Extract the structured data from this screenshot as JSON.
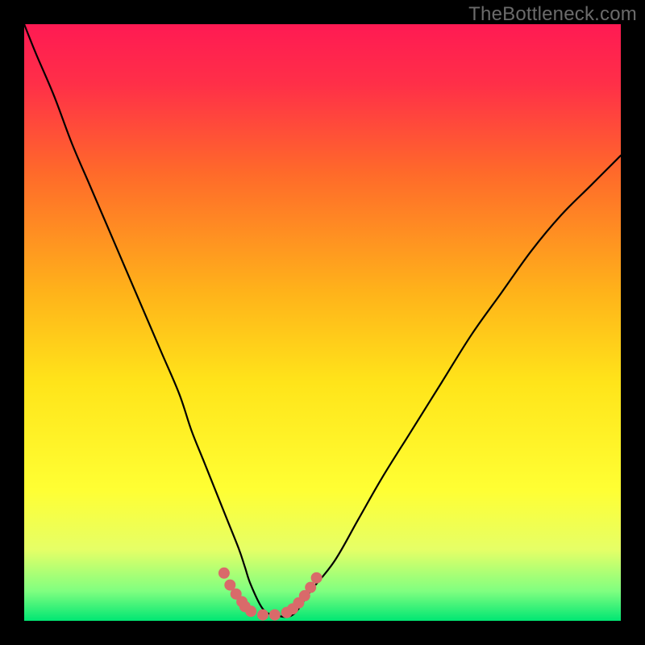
{
  "watermark": "TheBottleneck.com",
  "chart_data": {
    "type": "line",
    "title": "",
    "xlabel": "",
    "ylabel": "",
    "xlim": [
      0,
      100
    ],
    "ylim": [
      0,
      100
    ],
    "grid": false,
    "legend": false,
    "background_gradient_stops": [
      {
        "offset": 0.0,
        "color": "#ff1a53"
      },
      {
        "offset": 0.1,
        "color": "#ff2f48"
      },
      {
        "offset": 0.25,
        "color": "#ff6a2a"
      },
      {
        "offset": 0.45,
        "color": "#ffb31a"
      },
      {
        "offset": 0.6,
        "color": "#ffe41a"
      },
      {
        "offset": 0.78,
        "color": "#ffff33"
      },
      {
        "offset": 0.88,
        "color": "#e6ff66"
      },
      {
        "offset": 0.95,
        "color": "#80ff80"
      },
      {
        "offset": 1.0,
        "color": "#00e673"
      }
    ],
    "series": [
      {
        "name": "bottleneck-curve",
        "stroke": "#000000",
        "stroke_width": 2.2,
        "x": [
          0,
          2,
          5,
          8,
          11,
          14,
          17,
          20,
          23,
          26,
          28,
          30,
          32,
          34,
          36,
          37,
          38,
          40,
          42,
          45,
          48,
          52,
          56,
          60,
          65,
          70,
          75,
          80,
          85,
          90,
          95,
          100
        ],
        "y": [
          100,
          95,
          88,
          80,
          73,
          66,
          59,
          52,
          45,
          38,
          32,
          27,
          22,
          17,
          12,
          9,
          6,
          2,
          1,
          1,
          5,
          10,
          17,
          24,
          32,
          40,
          48,
          55,
          62,
          68,
          73,
          78
        ]
      },
      {
        "name": "trough-highlight",
        "stroke": "#d96a6a",
        "stroke_width": 14,
        "linecap": "round",
        "x": [
          33.5,
          34.5,
          35.5,
          36.5,
          37.0,
          38.0,
          40.0,
          42.0,
          44.0,
          45.0,
          46.0,
          47.0,
          48.0,
          49.0
        ],
        "y": [
          8.0,
          6.0,
          4.5,
          3.2,
          2.4,
          1.6,
          1.0,
          1.0,
          1.4,
          2.0,
          3.0,
          4.2,
          5.6,
          7.2
        ]
      }
    ],
    "annotations": []
  }
}
